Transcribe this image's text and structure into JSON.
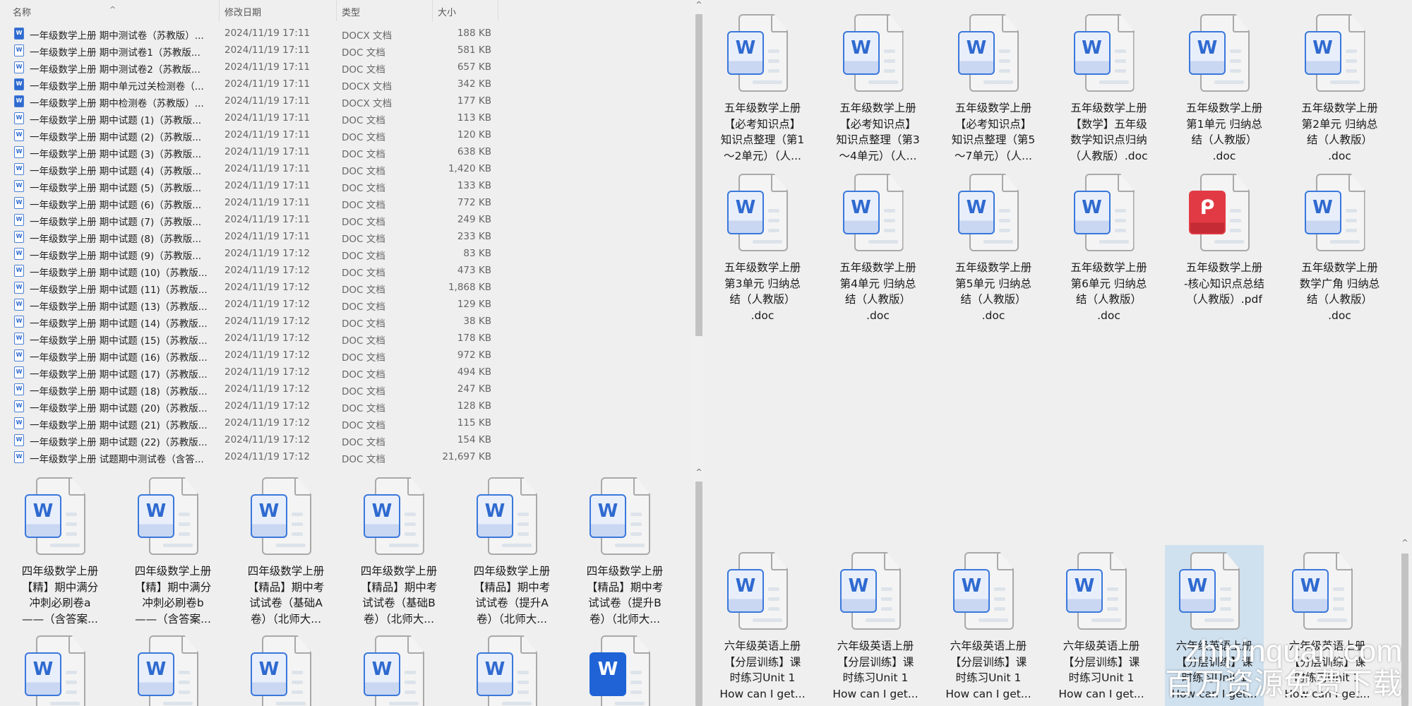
{
  "list_view": {
    "columns": {
      "name": "名称",
      "date": "修改日期",
      "type": "类型",
      "size": "大小"
    },
    "rows": [
      {
        "name": "一年级数学上册  期中测试卷（苏教版）...",
        "date": "2024/11/19 17:11",
        "type": "DOCX 文档",
        "size": "188 KB",
        "icon": "docx"
      },
      {
        "name": "一年级数学上册  期中测试卷1（苏教版...",
        "date": "2024/11/19 17:11",
        "type": "DOC 文档",
        "size": "581 KB",
        "icon": "doc"
      },
      {
        "name": "一年级数学上册  期中测试卷2（苏教版...",
        "date": "2024/11/19 17:11",
        "type": "DOC 文档",
        "size": "657 KB",
        "icon": "doc"
      },
      {
        "name": "一年级数学上册  期中单元过关检测卷（...",
        "date": "2024/11/19 17:11",
        "type": "DOCX 文档",
        "size": "342 KB",
        "icon": "docx"
      },
      {
        "name": "一年级数学上册  期中检测卷（苏教版）...",
        "date": "2024/11/19 17:11",
        "type": "DOCX 文档",
        "size": "177 KB",
        "icon": "docx"
      },
      {
        "name": "一年级数学上册  期中试题 (1)（苏教版...",
        "date": "2024/11/19 17:11",
        "type": "DOC 文档",
        "size": "113 KB",
        "icon": "doc"
      },
      {
        "name": "一年级数学上册  期中试题 (2)（苏教版...",
        "date": "2024/11/19 17:11",
        "type": "DOC 文档",
        "size": "120 KB",
        "icon": "doc"
      },
      {
        "name": "一年级数学上册  期中试题 (3)（苏教版...",
        "date": "2024/11/19 17:11",
        "type": "DOC 文档",
        "size": "638 KB",
        "icon": "doc"
      },
      {
        "name": "一年级数学上册  期中试题 (4)（苏教版...",
        "date": "2024/11/19 17:11",
        "type": "DOC 文档",
        "size": "1,420 KB",
        "icon": "doc"
      },
      {
        "name": "一年级数学上册  期中试题 (5)（苏教版...",
        "date": "2024/11/19 17:11",
        "type": "DOC 文档",
        "size": "133 KB",
        "icon": "doc"
      },
      {
        "name": "一年级数学上册  期中试题 (6)（苏教版...",
        "date": "2024/11/19 17:11",
        "type": "DOC 文档",
        "size": "772 KB",
        "icon": "doc"
      },
      {
        "name": "一年级数学上册  期中试题 (7)（苏教版...",
        "date": "2024/11/19 17:11",
        "type": "DOC 文档",
        "size": "249 KB",
        "icon": "doc"
      },
      {
        "name": "一年级数学上册  期中试题 (8)（苏教版...",
        "date": "2024/11/19 17:11",
        "type": "DOC 文档",
        "size": "233 KB",
        "icon": "doc"
      },
      {
        "name": "一年级数学上册  期中试题 (9)（苏教版...",
        "date": "2024/11/19 17:12",
        "type": "DOC 文档",
        "size": "83 KB",
        "icon": "doc"
      },
      {
        "name": "一年级数学上册  期中试题 (10)（苏教版...",
        "date": "2024/11/19 17:12",
        "type": "DOC 文档",
        "size": "473 KB",
        "icon": "doc"
      },
      {
        "name": "一年级数学上册  期中试题 (11)（苏教版...",
        "date": "2024/11/19 17:12",
        "type": "DOC 文档",
        "size": "1,868 KB",
        "icon": "doc"
      },
      {
        "name": "一年级数学上册  期中试题 (13)（苏教版...",
        "date": "2024/11/19 17:12",
        "type": "DOC 文档",
        "size": "129 KB",
        "icon": "doc"
      },
      {
        "name": "一年级数学上册  期中试题 (14)（苏教版...",
        "date": "2024/11/19 17:12",
        "type": "DOC 文档",
        "size": "38 KB",
        "icon": "doc"
      },
      {
        "name": "一年级数学上册  期中试题 (15)（苏教版...",
        "date": "2024/11/19 17:12",
        "type": "DOC 文档",
        "size": "178 KB",
        "icon": "doc"
      },
      {
        "name": "一年级数学上册  期中试题 (16)（苏教版...",
        "date": "2024/11/19 17:12",
        "type": "DOC 文档",
        "size": "972 KB",
        "icon": "doc"
      },
      {
        "name": "一年级数学上册  期中试题 (17)（苏教版...",
        "date": "2024/11/19 17:12",
        "type": "DOC 文档",
        "size": "494 KB",
        "icon": "doc"
      },
      {
        "name": "一年级数学上册  期中试题 (18)（苏教版...",
        "date": "2024/11/19 17:12",
        "type": "DOC 文档",
        "size": "247 KB",
        "icon": "doc"
      },
      {
        "name": "一年级数学上册  期中试题 (20)（苏教版...",
        "date": "2024/11/19 17:12",
        "type": "DOC 文档",
        "size": "128 KB",
        "icon": "doc"
      },
      {
        "name": "一年级数学上册  期中试题 (21)（苏教版...",
        "date": "2024/11/19 17:12",
        "type": "DOC 文档",
        "size": "115 KB",
        "icon": "doc"
      },
      {
        "name": "一年级数学上册  期中试题 (22)（苏教版...",
        "date": "2024/11/19 17:12",
        "type": "DOC 文档",
        "size": "154 KB",
        "icon": "doc"
      },
      {
        "name": "一年级数学上册  试题期中测试卷（含答...",
        "date": "2024/11/19 17:12",
        "type": "DOC 文档",
        "size": "21,697 KB",
        "icon": "doc"
      }
    ]
  },
  "grid_bottom_left": [
    {
      "lines": [
        "四年级数学上册",
        "【精】期中满分",
        "冲刺必刷卷a",
        "——（含答案..."
      ],
      "icon": "word"
    },
    {
      "lines": [
        "四年级数学上册",
        "【精】期中满分",
        "冲刺必刷卷b",
        "——（含答案..."
      ],
      "icon": "word"
    },
    {
      "lines": [
        "四年级数学上册",
        "【精品】期中考",
        "试试卷（基础A",
        "卷）（北师大..."
      ],
      "icon": "word"
    },
    {
      "lines": [
        "四年级数学上册",
        "【精品】期中考",
        "试试卷（基础B",
        "卷）（北师大..."
      ],
      "icon": "word"
    },
    {
      "lines": [
        "四年级数学上册",
        "【精品】期中考",
        "试试卷（提升A",
        "卷）（北师大..."
      ],
      "icon": "word"
    },
    {
      "lines": [
        "四年级数学上册",
        "【精品】期中考",
        "试试卷（提升B",
        "卷）（北师大..."
      ],
      "icon": "word"
    },
    {
      "lines": [],
      "icon": "word"
    },
    {
      "lines": [],
      "icon": "word"
    },
    {
      "lines": [],
      "icon": "word"
    },
    {
      "lines": [],
      "icon": "word"
    },
    {
      "lines": [],
      "icon": "word"
    },
    {
      "lines": [],
      "icon": "word-solid"
    }
  ],
  "grid_top_right": [
    {
      "lines": [
        "五年级数学上册",
        "【必考知识点】",
        "知识点整理（第1",
        "～2单元）（人..."
      ],
      "icon": "word"
    },
    {
      "lines": [
        "五年级数学上册",
        "【必考知识点】",
        "知识点整理（第3",
        "～4单元）（人..."
      ],
      "icon": "word"
    },
    {
      "lines": [
        "五年级数学上册",
        "【必考知识点】",
        "知识点整理（第5",
        "～7单元）（人..."
      ],
      "icon": "word"
    },
    {
      "lines": [
        "五年级数学上册",
        "【数学】五年级",
        "数学知识点归纳",
        "（人教版）.doc"
      ],
      "icon": "word"
    },
    {
      "lines": [
        "五年级数学上册",
        "第1单元  归纳总",
        "结（人教版）",
        ".doc"
      ],
      "icon": "word"
    },
    {
      "lines": [
        "五年级数学上册",
        "第2单元  归纳总",
        "结（人教版）",
        ".doc"
      ],
      "icon": "word"
    },
    {
      "lines": [
        "五年级数学上册",
        "第3单元  归纳总",
        "结（人教版）",
        ".doc"
      ],
      "icon": "word"
    },
    {
      "lines": [
        "五年级数学上册",
        "第4单元  归纳总",
        "结（人教版）",
        ".doc"
      ],
      "icon": "word"
    },
    {
      "lines": [
        "五年级数学上册",
        "第5单元  归纳总",
        "结（人教版）",
        ".doc"
      ],
      "icon": "word"
    },
    {
      "lines": [
        "五年级数学上册",
        "第6单元  归纳总",
        "结（人教版）",
        ".doc"
      ],
      "icon": "word"
    },
    {
      "lines": [
        "五年级数学上册",
        "-核心知识点总结",
        "（人教版）.pdf"
      ],
      "icon": "pdf"
    },
    {
      "lines": [
        "五年级数学上册",
        "数学广角  归纳总",
        "结（人教版）",
        ".doc"
      ],
      "icon": "word"
    }
  ],
  "grid_bottom_right": [
    {
      "lines": [
        "六年级英语上册",
        "【分层训练】课",
        "时练习Unit 1",
        "How can I get..."
      ],
      "icon": "word"
    },
    {
      "lines": [
        "六年级英语上册",
        "【分层训练】课",
        "时练习Unit 1",
        "How can I get..."
      ],
      "icon": "word"
    },
    {
      "lines": [
        "六年级英语上册",
        "【分层训练】课",
        "时练习Unit 1",
        "How can I get..."
      ],
      "icon": "word"
    },
    {
      "lines": [
        "六年级英语上册",
        "【分层训练】课",
        "时练习Unit 1",
        "How can I get..."
      ],
      "icon": "word"
    },
    {
      "lines": [
        "六年级英语上册",
        "【分层训练】课",
        "时练习Unit 1",
        "How can I get..."
      ],
      "icon": "word",
      "selected": true
    },
    {
      "lines": [
        "六年级英语上册",
        "【分层训练】课",
        "时练习Unit 1",
        "How can I get..."
      ],
      "icon": "word"
    }
  ],
  "watermark": {
    "line1": "zhipinquan.com",
    "line2": "百万资源免费下载"
  },
  "colors": {
    "word_blue": "#3a78dc",
    "pdf_red": "#e23a44",
    "selection": "#cfe0ee"
  }
}
